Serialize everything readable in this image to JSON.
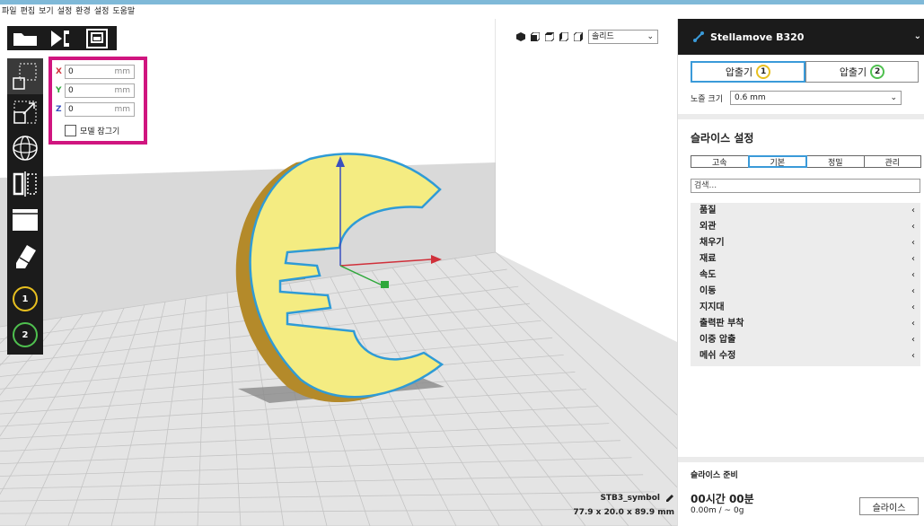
{
  "menu": [
    "파일",
    "편집",
    "보기",
    "설정",
    "환경",
    "설정",
    "도움말"
  ],
  "stage_tabs": [
    {
      "name": "open-file-tab",
      "icon": "folder-icon"
    },
    {
      "name": "prepare-tab",
      "icon": "prepare-icon"
    },
    {
      "name": "monitor-tab",
      "icon": "monitor-icon"
    }
  ],
  "tools": [
    {
      "name": "move-tool",
      "icon": "move-icon",
      "active": true
    },
    {
      "name": "scale-tool",
      "icon": "scale-icon"
    },
    {
      "name": "rotate-tool",
      "icon": "rotate-icon"
    },
    {
      "name": "mirror-tool",
      "icon": "mirror-icon"
    },
    {
      "name": "per-model-settings-tool",
      "icon": "per-model-icon"
    },
    {
      "name": "support-blocker-tool",
      "icon": "eraser-icon"
    }
  ],
  "extruder_buttons": [
    {
      "label": "1",
      "color": "#e8c020"
    },
    {
      "label": "2",
      "color": "#4fc04f"
    }
  ],
  "move_panel": {
    "x_label": "X",
    "y_label": "Y",
    "z_label": "Z",
    "x_value": "0",
    "y_value": "0",
    "z_value": "0",
    "unit": "mm",
    "lock_label": "모델 잠그기",
    "x_color": "#d0303a",
    "y_color": "#2fa83c",
    "z_color": "#3a4fbf"
  },
  "view": {
    "mode": "솔리드",
    "icons": [
      "3d-view-icon",
      "front-view-icon",
      "top-view-icon",
      "left-view-icon",
      "right-view-icon"
    ]
  },
  "object": {
    "name": "STB3_symbol",
    "dimensions": "77.9 x 20.0 x 89.9 mm"
  },
  "sidebar": {
    "printer_name": "Stellamove B320",
    "extruder_tabs": [
      {
        "label": "압출기",
        "num": "1",
        "color": "#e8c020",
        "active": true
      },
      {
        "label": "압출기",
        "num": "2",
        "color": "#4fc04f",
        "active": false
      }
    ],
    "nozzle_label": "노즐 크기",
    "nozzle_value": "0.6 mm",
    "slice_settings_title": "슬라이스 설정",
    "profile_tabs": [
      "고속",
      "기본",
      "정밀",
      "관리"
    ],
    "active_profile": 1,
    "search_placeholder": "검색...",
    "setting_categories": [
      "품질",
      "외관",
      "채우기",
      "재료",
      "속도",
      "이동",
      "지지대",
      "출력판 부착",
      "이중 압출",
      "메쉬 수정"
    ],
    "slice_ready_label": "슬라이스 준비",
    "time_estimate": "00시간 00분",
    "material_estimate": "0.00m / ~ 0g",
    "slice_button": "슬라이스"
  },
  "colors": {
    "accent": "#3a9ad9",
    "toolbar_bg": "#1b1b1b",
    "highlight": "#d0157f",
    "model_fill": "#f4ec82",
    "model_outline": "#2f9bd6"
  }
}
